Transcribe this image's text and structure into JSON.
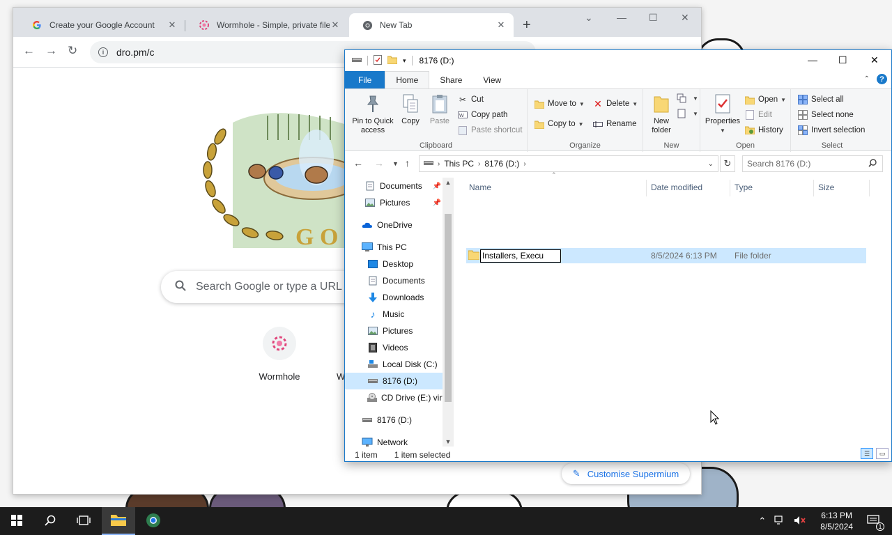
{
  "chrome": {
    "tabs": [
      {
        "title": "Create your Google Account",
        "icon": "google-g-icon"
      },
      {
        "title": "Wormhole - Simple, private file",
        "icon": "wormhole-icon"
      },
      {
        "title": "New Tab",
        "icon": "chrome-icon"
      }
    ],
    "new_tab_symbol": "+",
    "url": "dro.pm/c",
    "search_placeholder": "Search Google or type a URL",
    "shortcuts": [
      {
        "label": "Wormhole"
      },
      {
        "label": "W"
      }
    ],
    "customise_label": "Customise Supermium"
  },
  "explorer": {
    "title": "8176 (D:)",
    "ribbon_tabs": [
      "File",
      "Home",
      "Share",
      "View"
    ],
    "clipboard": {
      "pin_label_1": "Pin to Quick",
      "pin_label_2": "access",
      "copy_label": "Copy",
      "paste_label": "Paste",
      "cut_label": "Cut",
      "copy_path_label": "Copy path",
      "paste_shortcut_label": "Paste shortcut",
      "group_label": "Clipboard"
    },
    "organize": {
      "move_to_label": "Move to",
      "copy_to_label": "Copy to",
      "delete_label": "Delete",
      "rename_label": "Rename",
      "group_label": "Organize"
    },
    "new": {
      "new_folder_1": "New",
      "new_folder_2": "folder",
      "group_label": "New"
    },
    "open": {
      "properties_label": "Properties",
      "open_label": "Open",
      "edit_label": "Edit",
      "history_label": "History",
      "group_label": "Open"
    },
    "select": {
      "select_all_label": "Select all",
      "select_none_label": "Select none",
      "invert_label": "Invert selection",
      "group_label": "Select"
    },
    "address": {
      "crumbs": [
        "This PC",
        "8176 (D:)"
      ]
    },
    "search_placeholder": "Search 8176 (D:)",
    "nav_items": [
      {
        "label": "Documents",
        "icon": "documents-icon",
        "pinned": true
      },
      {
        "label": "Pictures",
        "icon": "pictures-icon",
        "pinned": true
      },
      {
        "label": "OneDrive",
        "icon": "onedrive-icon"
      },
      {
        "label": "This PC",
        "icon": "this-pc-icon"
      },
      {
        "label": "Desktop",
        "icon": "desktop-icon"
      },
      {
        "label": "Documents",
        "icon": "documents-icon"
      },
      {
        "label": "Downloads",
        "icon": "downloads-icon"
      },
      {
        "label": "Music",
        "icon": "music-icon"
      },
      {
        "label": "Pictures",
        "icon": "pictures-icon"
      },
      {
        "label": "Videos",
        "icon": "videos-icon"
      },
      {
        "label": "Local Disk (C:)",
        "icon": "local-disk-icon"
      },
      {
        "label": "8176 (D:)",
        "icon": "drive-icon",
        "selected": true
      },
      {
        "label": "CD Drive (E:) virt",
        "icon": "cd-drive-icon"
      },
      {
        "label": "8176 (D:)",
        "icon": "drive-icon"
      },
      {
        "label": "Network",
        "icon": "network-icon"
      }
    ],
    "columns": [
      "Name",
      "Date modified",
      "Type",
      "Size"
    ],
    "files": [
      {
        "name": "Installers, Execu",
        "date": "8/5/2024 6:13 PM",
        "type": "File folder",
        "size": ""
      }
    ],
    "status": {
      "count": "1 item",
      "selected": "1 item selected"
    }
  },
  "taskbar": {
    "time": "6:13 PM",
    "date": "8/5/2024",
    "notification_count": "1"
  },
  "colors": {
    "accent": "#1979ca",
    "selection": "#cce8ff",
    "chrome_link": "#1a73e8",
    "taskbar": "#1c1c1c"
  }
}
